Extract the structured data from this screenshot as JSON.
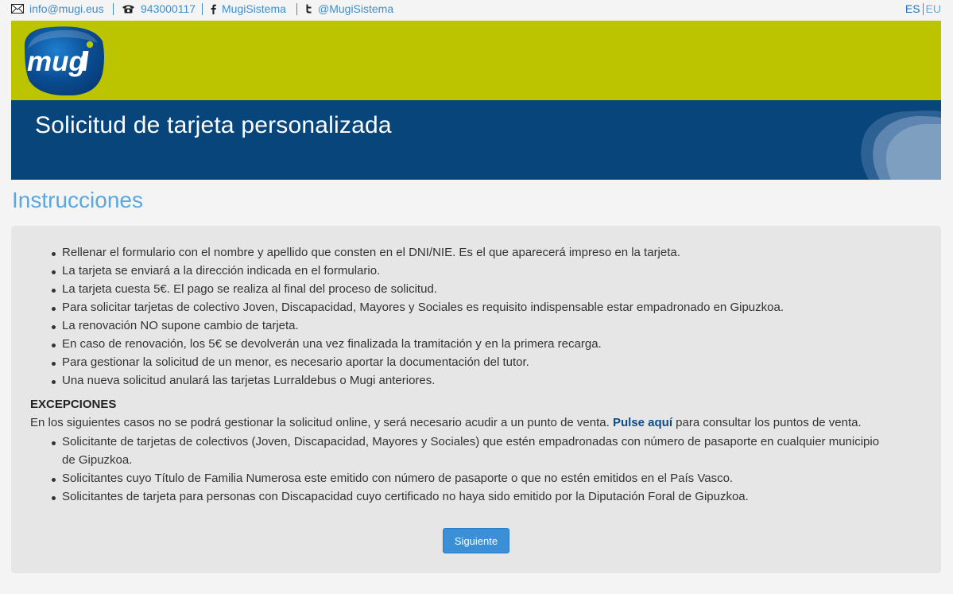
{
  "topbar": {
    "email": "info@mugi.eus",
    "phone": "943000117",
    "facebook": "MugiSistema",
    "twitter": "@MugiSistema",
    "lang_es": "ES",
    "lang_eu": "EU"
  },
  "logo": {
    "text": "mugi"
  },
  "banner": {
    "title": "Solicitud de tarjeta personalizada"
  },
  "instructions": {
    "title": "Instrucciones",
    "items": [
      "Rellenar el formulario con el nombre y apellido que consten en el DNI/NIE. Es el que aparecerá impreso en la tarjeta.",
      "La tarjeta se enviará a la dirección indicada en el formulario.",
      "La tarjeta cuesta 5€. El pago se realiza al final del proceso de solicitud.",
      "Para solicitar tarjetas de colectivo Joven, Discapacidad, Mayores y Sociales es requisito indispensable estar empadronado en Gipuzkoa.",
      "La renovación NO supone cambio de tarjeta.",
      "En caso de renovación, los 5€ se devolverán una vez finalizada la tramitación y en la primera recarga.",
      "Para gestionar la solicitud de un menor, es necesario aportar la documentación del tutor.",
      "Una nueva solicitud anulará las tarjetas Lurraldebus o Mugi anteriores."
    ]
  },
  "exceptions": {
    "title": "EXCEPCIONES",
    "text_before": "En los siguientes casos no se podrá gestionar la solicitud online, y será necesario acudir a un punto de venta.",
    "link": "Pulse aquí",
    "text_after": "para consultar los puntos de venta.",
    "items": [
      "Solicitante de tarjetas de colectivos (Joven, Discapacidad, Mayores y Sociales) que estén empadronadas con número de pasaporte en cualquier municipio de Gipuzkoa.",
      "Solicitantes cuyo Título de Familia Numerosa este emitido con número de pasaporte o que no estén emitidos en el País Vasco.",
      "Solicitantes de tarjeta para personas con Discapacidad cuyo certificado no haya sido emitido por la Diputación Foral de Gipuzkoa."
    ]
  },
  "button": {
    "next": "Siguiente"
  },
  "colors": {
    "header_green": "#bcc400",
    "banner_blue": "#07457a",
    "accent_blue": "#3a8fd6",
    "link_blue": "#0b4c8c",
    "title_blue": "#5ba7de"
  }
}
